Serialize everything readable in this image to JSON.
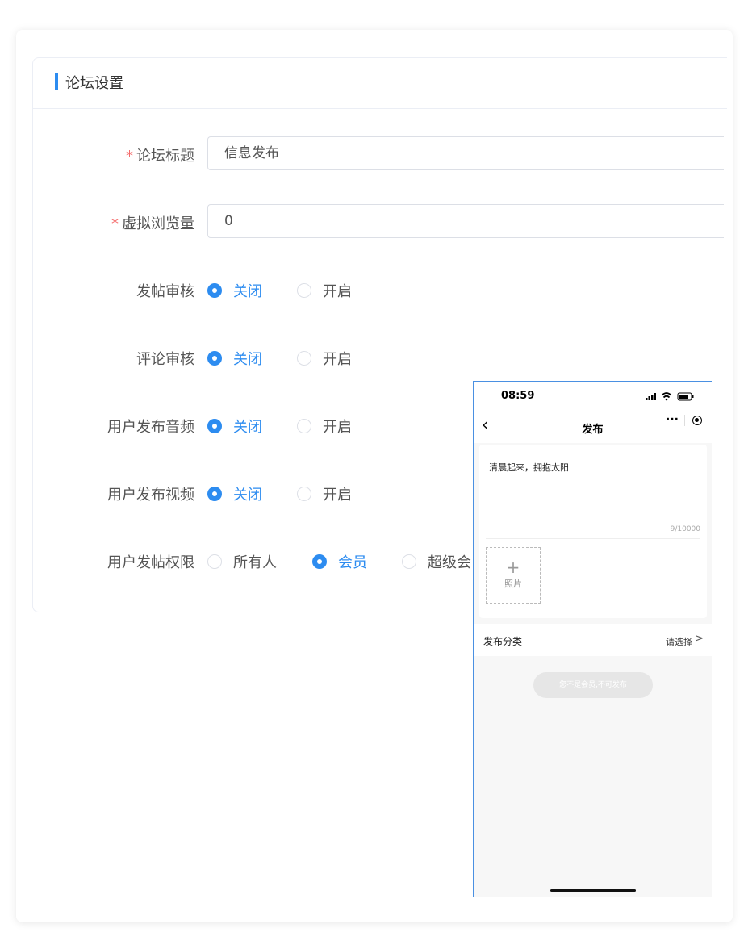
{
  "card": {
    "title": "论坛设置"
  },
  "form": {
    "required_mark": "*",
    "title_label": "论坛标题",
    "title_value": "信息发布",
    "views_label": "虚拟浏览量",
    "views_value": "0",
    "post_review": {
      "label": "发帖审核",
      "options": [
        "关闭",
        "开启"
      ],
      "selected": "关闭"
    },
    "comment_review": {
      "label": "评论审核",
      "options": [
        "关闭",
        "开启"
      ],
      "selected": "关闭"
    },
    "user_audio": {
      "label": "用户发布音频",
      "options": [
        "关闭",
        "开启"
      ],
      "selected": "关闭"
    },
    "user_video": {
      "label": "用户发布视频",
      "options": [
        "关闭",
        "开启"
      ],
      "selected": "关闭"
    },
    "post_permission": {
      "label": "用户发帖权限",
      "options": [
        "所有人",
        "会员",
        "超级会"
      ],
      "selected": "会员"
    }
  },
  "phone": {
    "time": "08:59",
    "back_icon": "chevron-left-icon",
    "title": "发布",
    "more_icon": "···",
    "post_text": "清晨起来，拥抱太阳",
    "counter": "9/10000",
    "upload_plus": "+",
    "upload_label": "照片",
    "category_label": "发布分类",
    "category_value": "请选择",
    "category_chevron": ">",
    "publish_button": "您不是会员,不可发布"
  },
  "colors": {
    "primary": "#2d8cf0",
    "required": "#f56c6c",
    "phone_border": "#4a90e2"
  }
}
